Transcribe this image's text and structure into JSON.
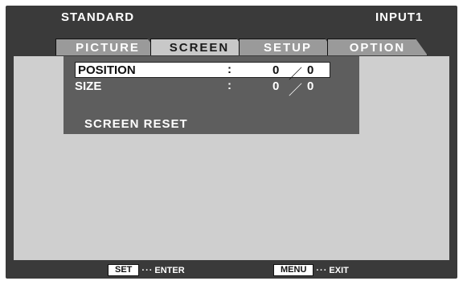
{
  "header": {
    "mode": "STANDARD",
    "input": "INPUT1"
  },
  "tabs": [
    {
      "label": "PICTURE"
    },
    {
      "label": "SCREEN"
    },
    {
      "label": "SETUP"
    },
    {
      "label": "OPTION"
    }
  ],
  "active_tab": "SCREEN",
  "menu": {
    "position": {
      "label": "POSITION",
      "colon": ":",
      "h": "0",
      "sep": "／",
      "v": "0"
    },
    "size": {
      "label": "SIZE",
      "colon": ":",
      "h": "0",
      "sep": "／",
      "v": "0"
    },
    "reset": "SCREEN RESET"
  },
  "footer": {
    "enter": {
      "key": "SET",
      "dots": "···",
      "action": "ENTER"
    },
    "exit": {
      "key": "MENU",
      "dots": "···",
      "action": "EXIT"
    }
  }
}
